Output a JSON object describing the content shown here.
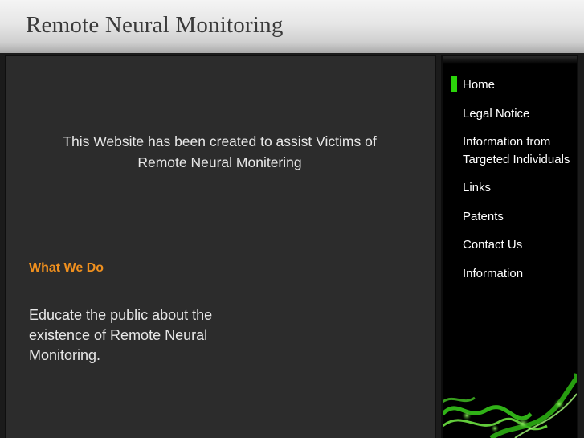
{
  "header": {
    "title": "Remote Neural Monitoring"
  },
  "main": {
    "intro": "This Website has been created to assist Victims of Remote Neural Monitering",
    "section_heading": "What We Do",
    "section_body": "Educate the public about the existence of Remote Neural Monitoring."
  },
  "nav": {
    "items": [
      {
        "label": "Home",
        "active": true
      },
      {
        "label": "Legal Notice"
      },
      {
        "label": "Information from Targeted Individuals"
      },
      {
        "label": "Links"
      },
      {
        "label": "Patents"
      },
      {
        "label": "Contact Us"
      },
      {
        "label": "Information"
      }
    ]
  },
  "colors": {
    "accent_green": "#2bd40a",
    "heading_orange": "#f0901e",
    "content_bg": "#2c2c2c",
    "sidebar_bg": "#000000"
  }
}
